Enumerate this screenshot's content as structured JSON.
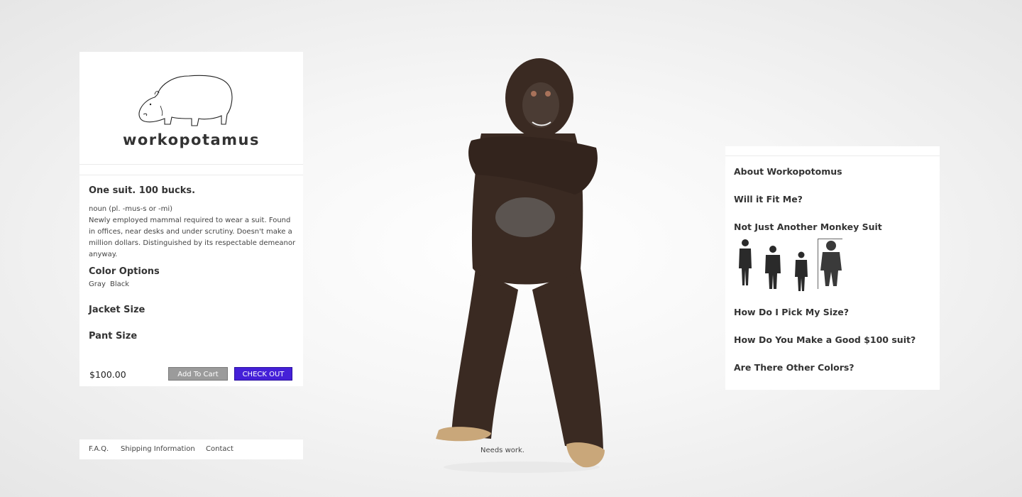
{
  "brand": {
    "name": "workopotamus"
  },
  "product": {
    "headline": "One suit. 100 bucks.",
    "definition_line1": "noun (pl. -mus-s or -mi)",
    "definition_body": "Newly employed mammal required to wear a suit. Found in offices, near desks and under scrutiny. Doesn't make a million dollars. Distinguished by its respectable demeanor anyway.",
    "color_options_title": "Color Options",
    "color_options": [
      "Gray",
      "Black"
    ],
    "jacket_size_title": "Jacket Size",
    "pant_size_title": "Pant Size",
    "price": "$100.00",
    "add_to_cart_label": "Add To Cart",
    "checkout_label": "CHECK OUT"
  },
  "footer": {
    "links": [
      "F.A.Q.",
      "Shipping Information",
      "Contact"
    ]
  },
  "info": {
    "items": [
      "About Workopotomus",
      "Will it Fit Me?",
      "Not Just Another Monkey Suit",
      "How Do I Pick My Size?",
      "How Do You Make a Good $100 suit?",
      "Are There Other Colors?"
    ],
    "silhouettes_selected_index": 3
  },
  "hero": {
    "caption": "Needs work."
  },
  "colors": {
    "checkout": "#4520d8",
    "cart": "#9b9b9b",
    "fur": "#3a2a22"
  }
}
